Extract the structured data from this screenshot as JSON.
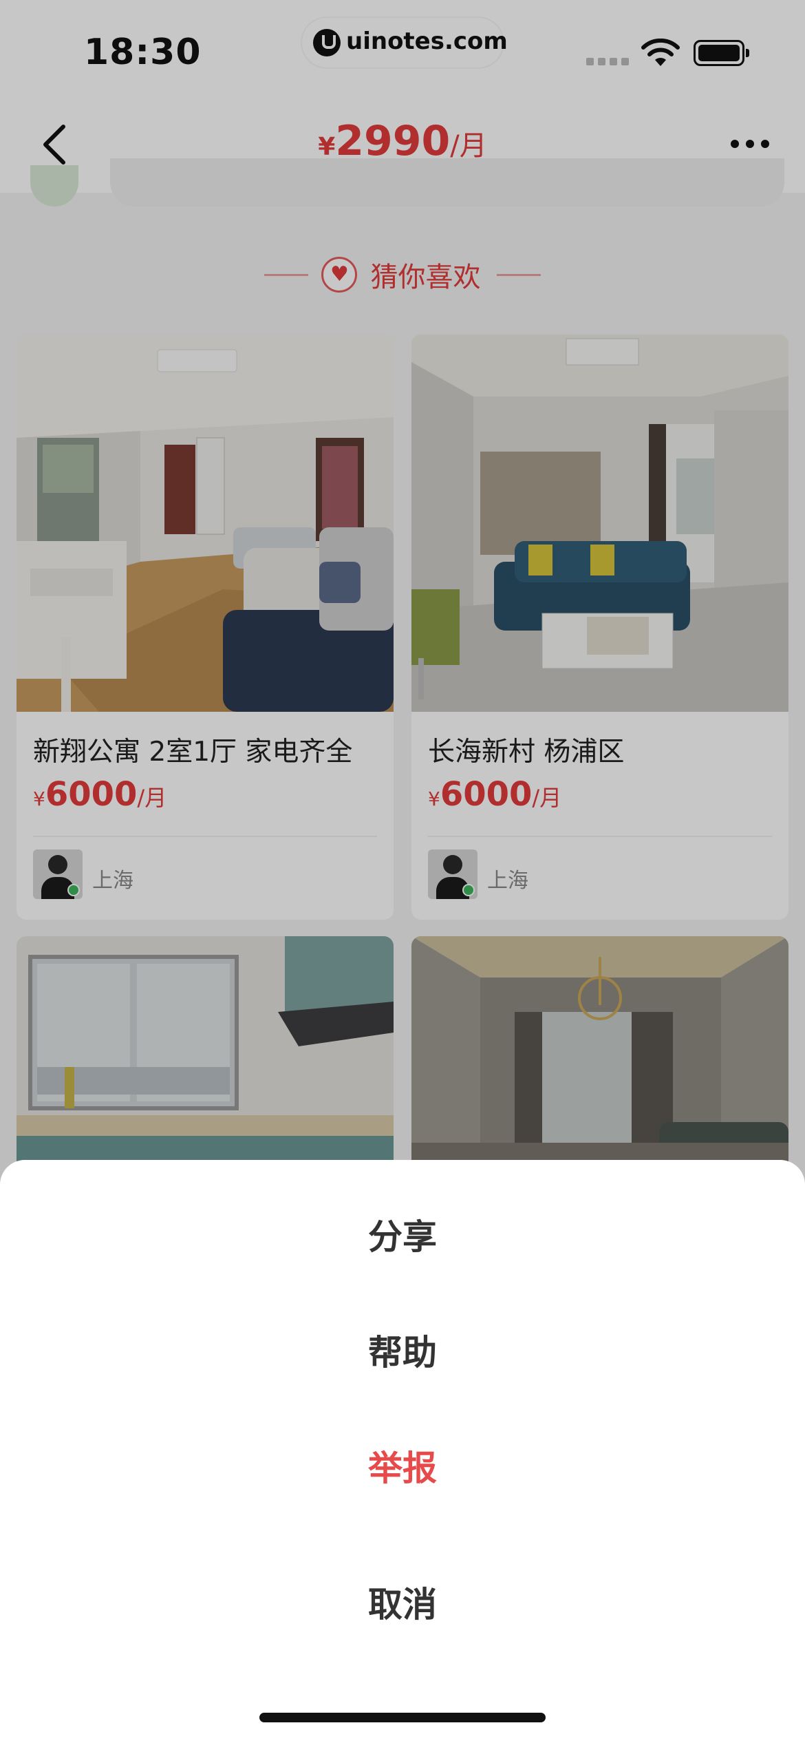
{
  "status_bar": {
    "time": "18:30",
    "watermark": "uinotes.com"
  },
  "nav": {
    "price_currency": "¥",
    "price_value": "2990",
    "price_unit": "/月"
  },
  "recommendations": {
    "heading": "猜你喜欢",
    "cards": [
      {
        "title": "新翔公寓 2室1厅 家电齐全",
        "price_currency": "¥",
        "price_value": "6000",
        "price_unit": "/月",
        "city": "上海"
      },
      {
        "title": "长海新村 杨浦区",
        "price_currency": "¥",
        "price_value": "6000",
        "price_unit": "/月",
        "city": "上海"
      }
    ]
  },
  "action_sheet": {
    "share": "分享",
    "help": "帮助",
    "report": "举报",
    "cancel": "取消"
  },
  "colors": {
    "accent": "#e33b3b",
    "report": "#e64a4a",
    "online": "#3db55c"
  }
}
